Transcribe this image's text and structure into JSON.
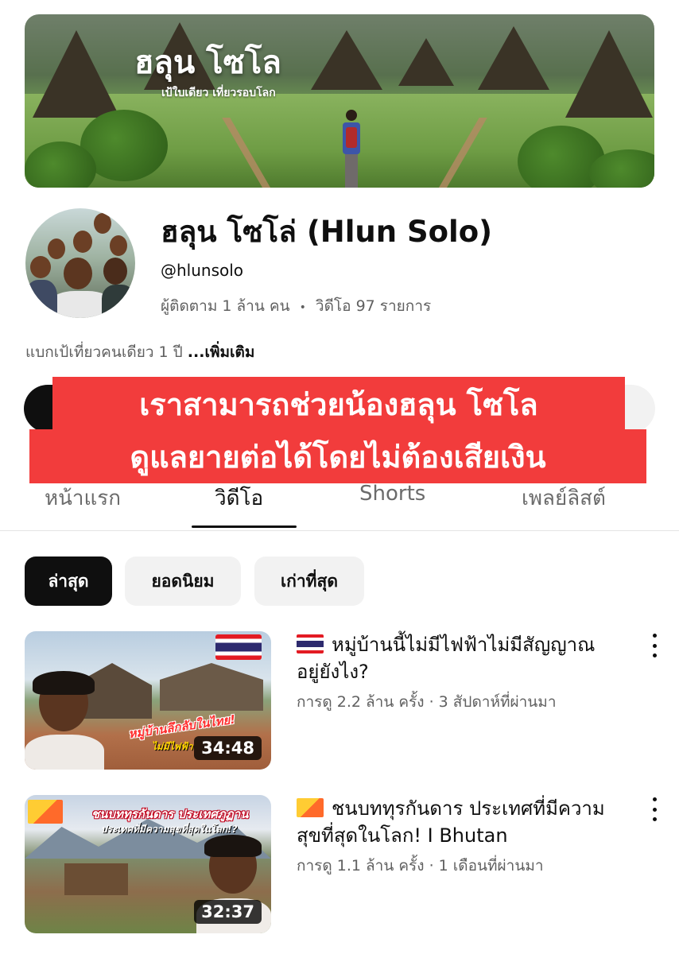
{
  "banner": {
    "title": "ฮลุน โซโล",
    "subtitle": "เป้ใบเดียว เที่ยวรอบโลก"
  },
  "channel": {
    "name": "ฮลุน โซโล่ (Hlun Solo)",
    "handle": "@hlunsolo",
    "subscribers": "ผู้ติดตาม 1 ล้าน คน",
    "separator": "•",
    "videos_count": "วิดีโอ 97 รายการ",
    "description": "แบกเป้เที่ยวคนเดียว 1 ปี ",
    "more_label": "...เพิ่มเติม"
  },
  "overlay": {
    "line1": "เราสามารถช่วยน้องฮลุน โซโล",
    "line2": "ดูแลยายต่อได้โดยไม่ต้องเสียเงิน",
    "color": "#f23c3c"
  },
  "tabs": [
    {
      "label": "หน้าแรก",
      "active": false
    },
    {
      "label": "วิดีโอ",
      "active": true
    },
    {
      "label": "Shorts",
      "active": false
    },
    {
      "label": "เพลย์ลิสต์",
      "active": false
    }
  ],
  "chips": [
    {
      "label": "ล่าสุด",
      "active": true
    },
    {
      "label": "ยอดนิยม",
      "active": false
    },
    {
      "label": "เก่าที่สุด",
      "active": false
    }
  ],
  "videos": [
    {
      "flag": "thailand-flag-icon",
      "title": "หมู่บ้านนี้ไม่มีไฟฟ้าไม่มีสัญญาณ อยู่ยังไง?",
      "meta": "การดู 2.2 ล้าน ครั้ง · 3 สัปดาห์ที่ผ่านมา",
      "duration": "34:48",
      "thumb_caption_1": "หมู่บ้านลึกลับในไทย!",
      "thumb_caption_2": "ไม่มีไฟฟ้า"
    },
    {
      "flag": "bhutan-flag-icon",
      "title": "ชนบททุรกันดาร ประเทศที่มีความสุขที่สุดในโลก! I Bhutan",
      "meta": "การดู 1.1 ล้าน ครั้ง · 1 เดือนที่ผ่านมา",
      "duration": "32:37",
      "thumb_caption_1": "ชนบททุรกันดาร ประเทศภูฏาน",
      "thumb_caption_2": "ประเทศที่มีความสุขที่สุดในโลก!?"
    }
  ]
}
